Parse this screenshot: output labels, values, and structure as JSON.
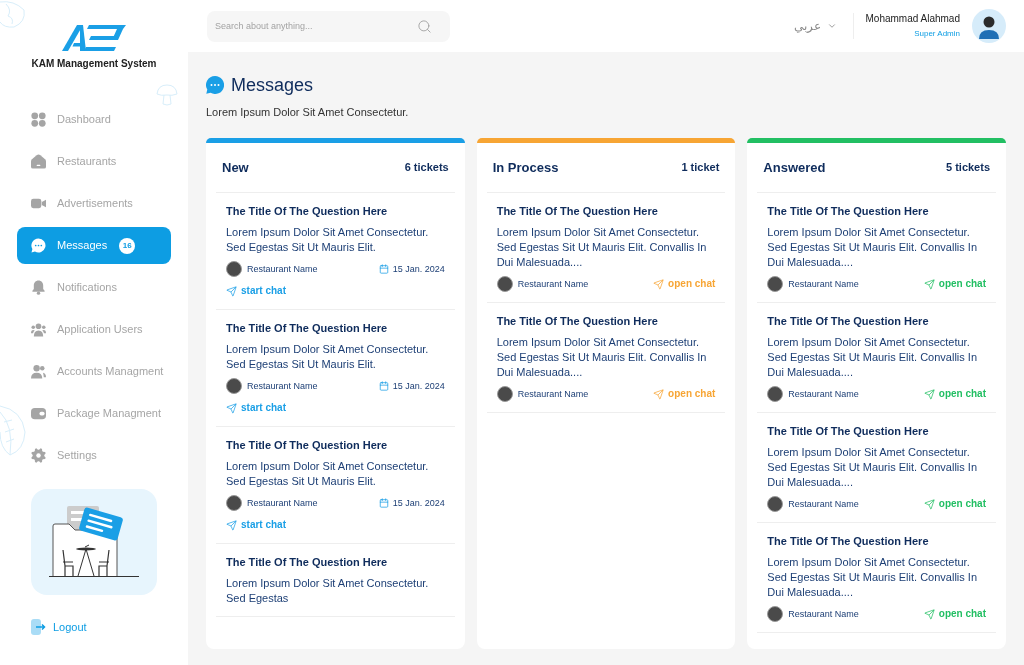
{
  "sidebar": {
    "brand": "KAM Management System",
    "items": [
      {
        "label": "Dashboard",
        "selected": false
      },
      {
        "label": "Restaurants",
        "selected": false
      },
      {
        "label": "Advertisements",
        "selected": false
      },
      {
        "label": "Messages",
        "selected": true,
        "badge": "16"
      },
      {
        "label": "Notifications",
        "selected": false
      },
      {
        "label": "Application Users",
        "selected": false
      },
      {
        "label": "Accounts Managment",
        "selected": false
      },
      {
        "label": "Package Managment",
        "selected": false
      },
      {
        "label": "Settings",
        "selected": false
      }
    ],
    "logout": "Logout"
  },
  "header": {
    "search": {
      "placeholder": "Search about anything..."
    },
    "language": "عربي",
    "user": {
      "name": "Mohammad Alahmad",
      "role": "Super Admin"
    }
  },
  "page": {
    "title": "Messages",
    "subtitle": "Lorem Ipsum Dolor Sit Amet Consectetur."
  },
  "columns": [
    {
      "title": "New",
      "count": "6 tickets",
      "color": "#1a9fe6",
      "tickets": [
        {
          "title": "The Title Of The Question Here",
          "description": "Lorem Ipsum Dolor Sit Amet Consectetur. Sed Egestas Sit Ut Mauris Elit.",
          "restaurant": "Restaurant Name",
          "date": "15 Jan. 2024",
          "action": "start chat"
        },
        {
          "title": "The Title Of The Question Here",
          "description": "Lorem Ipsum Dolor Sit Amet Consectetur. Sed Egestas Sit Ut Mauris Elit.",
          "restaurant": "Restaurant Name",
          "date": "15 Jan. 2024",
          "action": "start chat"
        },
        {
          "title": "The Title Of The Question Here",
          "description": "Lorem Ipsum Dolor Sit Amet Consectetur. Sed Egestas Sit Ut Mauris Elit.",
          "restaurant": "Restaurant Name",
          "date": "15 Jan. 2024",
          "action": "start chat"
        },
        {
          "title": "The Title Of The Question Here",
          "description": "Lorem Ipsum Dolor Sit Amet Consectetur. Sed Egestas"
        }
      ]
    },
    {
      "title": "In Process",
      "count": "1 ticket",
      "color": "#f7a534",
      "tickets": [
        {
          "title": "The Title Of The Question Here",
          "description": "Lorem Ipsum Dolor Sit Amet Consectetur. Sed Egestas Sit Ut Mauris Elit. Convallis In Dui Malesuada....",
          "restaurant": "Restaurant Name",
          "action": "open chat"
        },
        {
          "title": "The Title Of The Question Here",
          "description": "Lorem Ipsum Dolor Sit Amet Consectetur. Sed Egestas Sit Ut Mauris Elit. Convallis In Dui Malesuada....",
          "restaurant": "Restaurant Name",
          "action": "open chat"
        }
      ]
    },
    {
      "title": "Answered",
      "count": "5 tickets",
      "color": "#22bf63",
      "tickets": [
        {
          "title": "The Title Of The Question Here",
          "description": "Lorem Ipsum Dolor Sit Amet Consectetur. Sed Egestas Sit Ut Mauris Elit. Convallis In Dui Malesuada....",
          "restaurant": "Restaurant Name",
          "action": "open chat"
        },
        {
          "title": "The Title Of The Question Here",
          "description": "Lorem Ipsum Dolor Sit Amet Consectetur. Sed Egestas Sit Ut Mauris Elit. Convallis In Dui Malesuada....",
          "restaurant": "Restaurant Name",
          "action": "open chat"
        },
        {
          "title": "The Title Of The Question Here",
          "description": "Lorem Ipsum Dolor Sit Amet Consectetur. Sed Egestas Sit Ut Mauris Elit. Convallis In Dui Malesuada....",
          "restaurant": "Restaurant Name",
          "action": "open chat"
        },
        {
          "title": "The Title Of The Question Here",
          "description": "Lorem Ipsum Dolor Sit Amet Consectetur. Sed Egestas Sit Ut Mauris Elit. Convallis In Dui Malesuada....",
          "restaurant": "Restaurant Name",
          "action": "open chat"
        }
      ]
    }
  ]
}
